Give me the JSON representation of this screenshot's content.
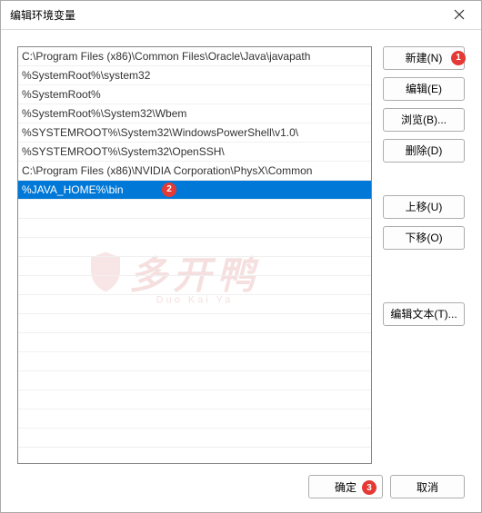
{
  "title": "编辑环境变量",
  "list": {
    "items": [
      "C:\\Program Files (x86)\\Common Files\\Oracle\\Java\\javapath",
      "%SystemRoot%\\system32",
      "%SystemRoot%",
      "%SystemRoot%\\System32\\Wbem",
      "%SYSTEMROOT%\\System32\\WindowsPowerShell\\v1.0\\",
      "%SYSTEMROOT%\\System32\\OpenSSH\\",
      "C:\\Program Files (x86)\\NVIDIA Corporation\\PhysX\\Common",
      "%JAVA_HOME%\\bin"
    ],
    "selected_index": 7
  },
  "buttons": {
    "new": "新建(N)",
    "edit": "编辑(E)",
    "browse": "浏览(B)...",
    "delete": "删除(D)",
    "move_up": "上移(U)",
    "move_down": "下移(O)",
    "edit_text": "编辑文本(T)...",
    "ok": "确定",
    "cancel": "取消"
  },
  "markers": {
    "m1": "1",
    "m2": "2",
    "m3": "3"
  },
  "watermark": {
    "cn": "多开鸭",
    "en": "Duo Kai Ya"
  }
}
